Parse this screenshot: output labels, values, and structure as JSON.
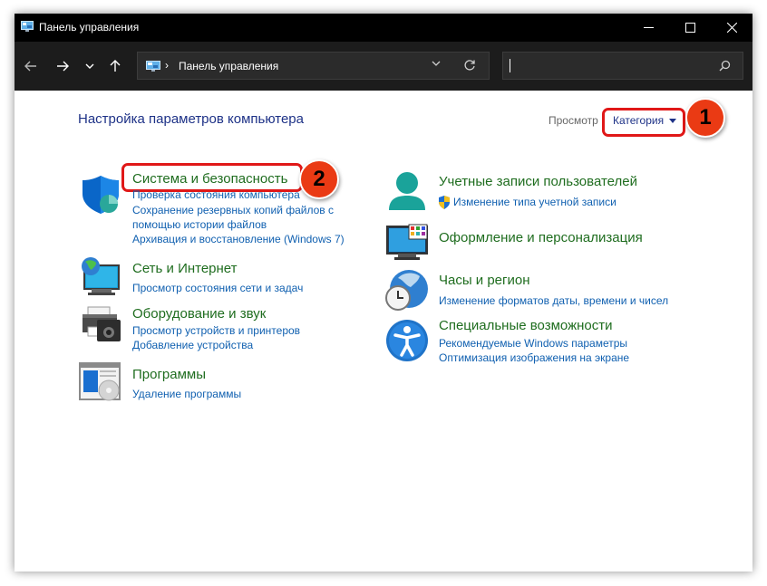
{
  "window": {
    "title": "Панель управления",
    "controls": [
      "minimize",
      "maximize",
      "close"
    ]
  },
  "navigation": {
    "back": "arrow-left-icon",
    "forward": "arrow-right-icon",
    "recent": "chevron-down-icon",
    "up": "arrow-up-icon",
    "address": "Панель управления",
    "search_placeholder": ""
  },
  "page": {
    "title": "Настройка параметров компьютера",
    "view_label": "Просмотр",
    "view_value": "Категория"
  },
  "annotations": {
    "badge1": "1",
    "badge2": "2"
  },
  "categories": {
    "system": {
      "title": "Система и безопасность",
      "links": [
        "Проверка состояния компьютера",
        "Сохранение резервных копий файлов с",
        "помощью истории файлов",
        "Архивация и восстановление (Windows 7)"
      ]
    },
    "network": {
      "title": "Сеть и Интернет",
      "links": [
        "Просмотр состояния сети и задач"
      ]
    },
    "hardware": {
      "title": "Оборудование и звук",
      "links": [
        "Просмотр устройств и принтеров",
        "Добавление устройства"
      ]
    },
    "programs": {
      "title": "Программы",
      "links": [
        "Удаление программы"
      ]
    },
    "accounts": {
      "title": "Учетные записи пользователей",
      "links": [
        "Изменение типа учетной записи"
      ]
    },
    "appearance": {
      "title": "Оформление и персонализация",
      "links": []
    },
    "clock": {
      "title": "Часы и регион",
      "links": [
        "Изменение форматов даты, времени и чисел"
      ]
    },
    "access": {
      "title": "Специальные возможности",
      "links": [
        "Рекомендуемые Windows параметры",
        "Оптимизация изображения на экране"
      ]
    }
  },
  "colors": {
    "title_bar": "#000000",
    "nav_bar": "#1c1c1c",
    "category_title": "#1f6d1f",
    "link": "#1060b0",
    "highlight": "#e01818",
    "badge": "#ea3a14"
  }
}
